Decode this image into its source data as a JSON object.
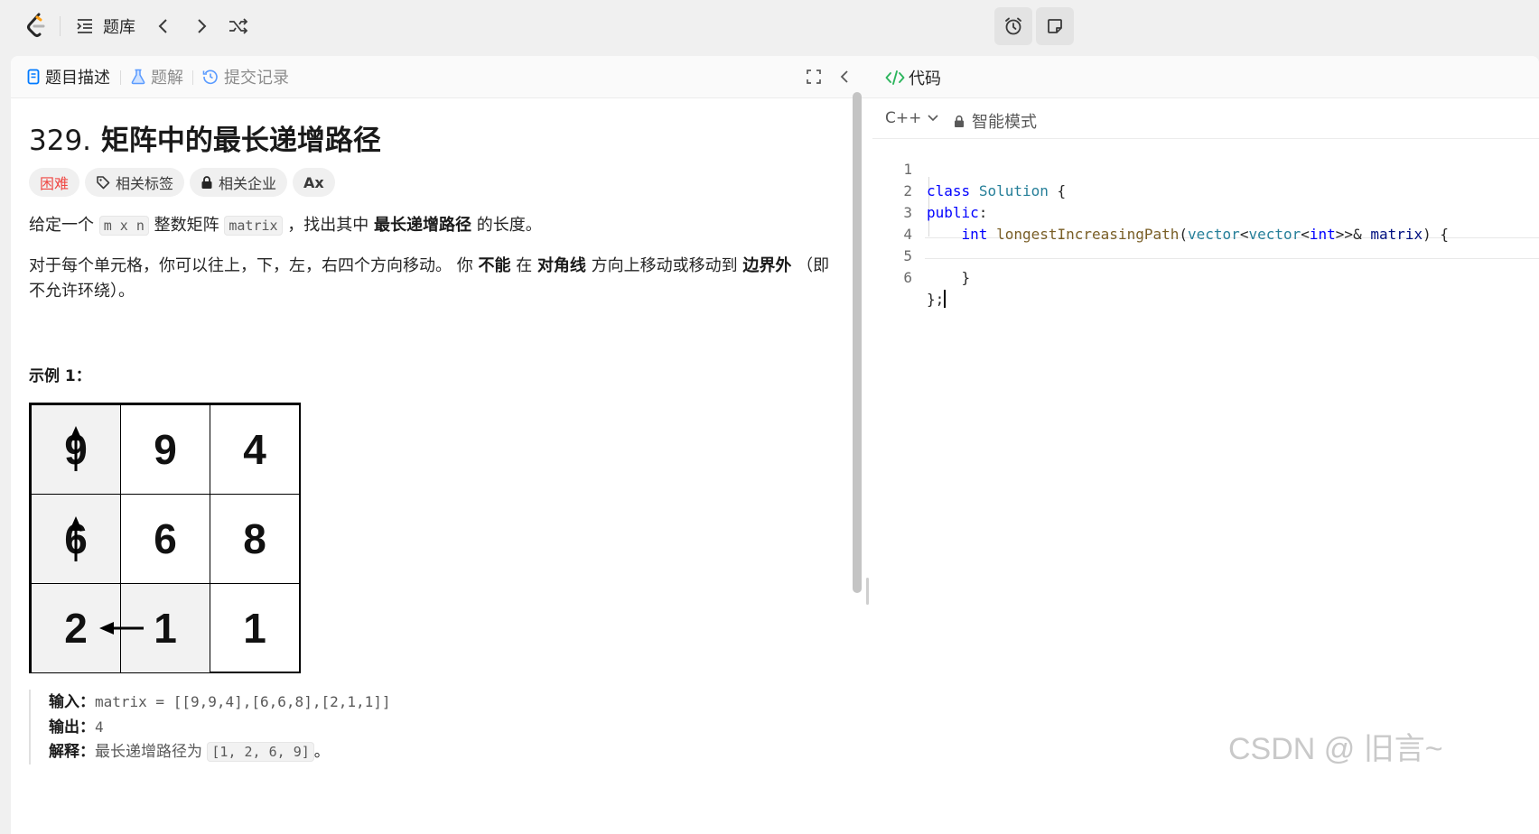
{
  "topbar": {
    "problem_bank_label": "题库"
  },
  "left_tabs": [
    {
      "label": "题目描述"
    },
    {
      "label": "题解"
    },
    {
      "label": "提交记录"
    }
  ],
  "problem": {
    "number": "329.",
    "title": "矩阵中的最长递增路径",
    "difficulty": "困难",
    "tags_label": "相关标签",
    "companies_label": "相关企业",
    "font_btn_label": "Ax",
    "desc1_prefix": "给定一个",
    "desc1_code1": "m x n",
    "desc1_mid": "整数矩阵",
    "desc1_code2": "matrix",
    "desc1_mid2": "，找出其中",
    "desc1_bold": "最长递增路径",
    "desc1_suffix": "的长度。",
    "desc2_a": "对于每个单元格，你可以往上，下，左，右四个方向移动。 你",
    "desc2_b": "不能",
    "desc2_c": "在",
    "desc2_d": "对角线",
    "desc2_e": "方向上移动或移动到",
    "desc2_f": "边界外",
    "desc2_g": "（即不允许",
    "desc2_h": "环绕）。",
    "example_title": "示例 1：",
    "grid": [
      [
        "9",
        "9",
        "4"
      ],
      [
        "6",
        "6",
        "8"
      ],
      [
        "2",
        "1",
        "1"
      ]
    ],
    "input_label": "输入：",
    "input_value": "matrix = [[9,9,4],[6,6,8],[2,1,1]]",
    "output_label": "输出：",
    "output_value": "4",
    "explain_label": "解释：",
    "explain_text": "最长递增路径为",
    "explain_code": "[1, 2, 6, 9]",
    "explain_end": "。"
  },
  "code_panel": {
    "tab_label": "代码",
    "language": "C++",
    "mode_label": "智能模式",
    "line_numbers": [
      "1",
      "2",
      "3",
      "4",
      "5",
      "6"
    ]
  },
  "watermark": "CSDN @ 旧言~",
  "colors": {
    "accent": "#007aff",
    "hard": "#ef4743",
    "code_green": "#2db55d"
  }
}
